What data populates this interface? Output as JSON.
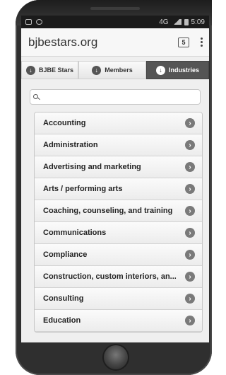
{
  "browser": {
    "url": "bjbestars.org",
    "tab_count": "5"
  },
  "status_bar": {
    "time": "5:09",
    "network": "4G"
  },
  "tabs": [
    {
      "label": "BJBE Stars",
      "active": false
    },
    {
      "label": "Members",
      "active": false
    },
    {
      "label": "Industries",
      "active": true
    }
  ],
  "search": {
    "value": "",
    "placeholder": ""
  },
  "industries": [
    "Accounting",
    "Administration",
    "Advertising and marketing",
    "Arts / performing arts",
    "Coaching, counseling, and training",
    "Communications",
    "Compliance",
    "Construction, custom interiors, an...",
    "Consulting",
    "Education"
  ],
  "icons": {
    "tab_icon": "arrow-down-circle-icon",
    "list_chevron": "chevron-right-circle-icon"
  }
}
